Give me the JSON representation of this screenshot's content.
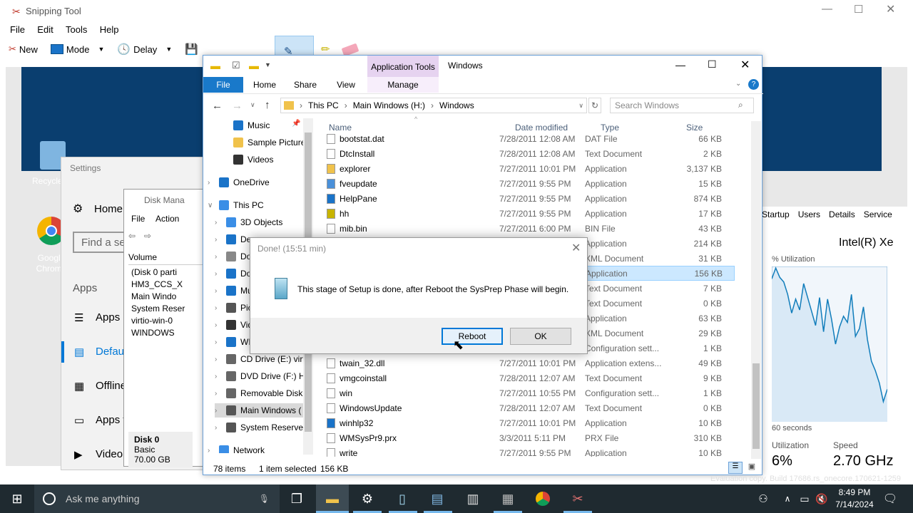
{
  "snipping": {
    "title": "Snipping Tool",
    "menu": [
      "File",
      "Edit",
      "Tools",
      "Help"
    ],
    "toolbar": {
      "new": "New",
      "mode": "Mode",
      "delay": "Delay"
    }
  },
  "desktop": {
    "recycle": "Recycle",
    "chrome": "Google Chrome"
  },
  "settings": {
    "title": "Settings",
    "home": "Home",
    "search_placeholder": "Find a se",
    "section": "Apps",
    "items": [
      "Apps",
      "Defaul",
      "Offline",
      "Apps f",
      "Video"
    ]
  },
  "diskmgmt": {
    "title": "Disk Mana",
    "menu": [
      "File",
      "Action"
    ],
    "col": "Volume",
    "vols": [
      "(Disk 0 parti",
      "HM3_CCS_X",
      "Main Windo",
      "System Reser",
      "virtio-win-0",
      "WINDOWS"
    ],
    "disk": "Disk 0",
    "basic": "Basic",
    "size": "70.00 GB"
  },
  "taskmgr": {
    "tabs": [
      "Startup",
      "Users",
      "Details",
      "Service"
    ],
    "cpu": "Intel(R) Xe",
    "util_label": "% Utilization",
    "seconds": "60 seconds",
    "utilization": "Utilization",
    "speed": "Speed",
    "util_val": "6%",
    "speed_val": "2.70 GHz",
    "graph": [
      92,
      99,
      93,
      90,
      82,
      70,
      79,
      72,
      89,
      80,
      71,
      62,
      80,
      58,
      79,
      66,
      50,
      61,
      68,
      64,
      82,
      55,
      60,
      74,
      53,
      39,
      33,
      25,
      13,
      21
    ]
  },
  "explorer": {
    "context_tab": "Application Tools",
    "title": "Windows",
    "tabs": {
      "file": "File",
      "home": "Home",
      "share": "Share",
      "view": "View",
      "manage": "Manage"
    },
    "path": [
      "This PC",
      "Main Windows (H:)",
      "Windows"
    ],
    "search_placeholder": "Search Windows",
    "cols": {
      "name": "Name",
      "date": "Date modified",
      "type": "Type",
      "size": "Size"
    },
    "nav": [
      {
        "label": "Music",
        "icon": "music-note-icon",
        "color": "#1a73c8"
      },
      {
        "label": "Sample Pictures",
        "icon": "folder-icon",
        "color": "#f0c24b"
      },
      {
        "label": "Videos",
        "icon": "video-icon",
        "color": "#333"
      },
      {
        "label": "OneDrive",
        "icon": "cloud-icon",
        "color": "#1a73c8"
      },
      {
        "label": "This PC",
        "icon": "computer-icon",
        "color": "#3a8ee6"
      },
      {
        "label": "3D Objects",
        "icon": "cube-icon",
        "color": "#3a8ee6"
      },
      {
        "label": "De",
        "icon": "desktop-icon",
        "color": "#1a73c8"
      },
      {
        "label": "Do",
        "icon": "document-icon",
        "color": "#888"
      },
      {
        "label": "Do",
        "icon": "download-icon",
        "color": "#1a73c8"
      },
      {
        "label": "Mu",
        "icon": "music-note-icon",
        "color": "#1a73c8"
      },
      {
        "label": "Pic",
        "icon": "picture-icon",
        "color": "#555"
      },
      {
        "label": "Vid",
        "icon": "video-icon",
        "color": "#333"
      },
      {
        "label": "WI",
        "icon": "drive-icon",
        "color": "#1a73c8"
      },
      {
        "label": "CD Drive (E:) virt",
        "icon": "cd-icon",
        "color": "#666"
      },
      {
        "label": "DVD Drive (F:) H",
        "icon": "dvd-icon",
        "color": "#666"
      },
      {
        "label": "Removable Disk",
        "icon": "usb-icon",
        "color": "#666"
      },
      {
        "label": "Main Windows (",
        "icon": "drive-icon",
        "color": "#555"
      },
      {
        "label": "System Reserved",
        "icon": "drive-icon",
        "color": "#555"
      },
      {
        "label": "Network",
        "icon": "network-icon",
        "color": "#3a8ee6"
      }
    ],
    "files": [
      {
        "name": "bootstat.dat",
        "date": "7/28/2011 12:08 AM",
        "type": "DAT File",
        "size": "66 KB"
      },
      {
        "name": "DtcInstall",
        "date": "7/28/2011 12:08 AM",
        "type": "Text Document",
        "size": "2 KB"
      },
      {
        "name": "explorer",
        "date": "7/27/2011 10:01 PM",
        "type": "Application",
        "size": "3,137 KB"
      },
      {
        "name": "fveupdate",
        "date": "7/27/2011 9:55 PM",
        "type": "Application",
        "size": "15 KB"
      },
      {
        "name": "HelpPane",
        "date": "7/27/2011 9:55 PM",
        "type": "Application",
        "size": "874 KB"
      },
      {
        "name": "hh",
        "date": "7/27/2011 9:55 PM",
        "type": "Application",
        "size": "17 KB"
      },
      {
        "name": "mib.bin",
        "date": "7/27/2011 6:00 PM",
        "type": "BIN File",
        "size": "43 KB"
      },
      {
        "name": "",
        "date": "",
        "type": "Application",
        "size": "214 KB"
      },
      {
        "name": "",
        "date": "",
        "type": "XML Document",
        "size": "31 KB"
      },
      {
        "name": "",
        "date": "",
        "type": "Application",
        "size": "156 KB"
      },
      {
        "name": "",
        "date": "",
        "type": "Text Document",
        "size": "7 KB"
      },
      {
        "name": "",
        "date": "",
        "type": "Text Document",
        "size": "0 KB"
      },
      {
        "name": "",
        "date": "",
        "type": "Application",
        "size": "63 KB"
      },
      {
        "name": "",
        "date": "",
        "type": "XML Document",
        "size": "29 KB"
      },
      {
        "name": "",
        "date": "",
        "type": "Configuration sett...",
        "size": "1 KB"
      },
      {
        "name": "twain_32.dll",
        "date": "7/27/2011 10:01 PM",
        "type": "Application extens...",
        "size": "49 KB"
      },
      {
        "name": "vmgcoinstall",
        "date": "7/28/2011 12:07 AM",
        "type": "Text Document",
        "size": "9 KB"
      },
      {
        "name": "win",
        "date": "7/27/2011 10:55 PM",
        "type": "Configuration sett...",
        "size": "1 KB"
      },
      {
        "name": "WindowsUpdate",
        "date": "7/28/2011 12:07 AM",
        "type": "Text Document",
        "size": "0 KB"
      },
      {
        "name": "winhlp32",
        "date": "7/27/2011 10:01 PM",
        "type": "Application",
        "size": "10 KB"
      },
      {
        "name": "WMSysPr9.prx",
        "date": "3/3/2011 5:11 PM",
        "type": "PRX File",
        "size": "310 KB"
      },
      {
        "name": "write",
        "date": "7/27/2011 9:55 PM",
        "type": "Application",
        "size": "10 KB"
      }
    ],
    "selected_index": 9,
    "status": {
      "items": "78 items",
      "selected": "1 item selected",
      "size": "156 KB"
    }
  },
  "dialog": {
    "title": "Done! (15:51 min)",
    "message": "This stage of Setup is done, after Reboot the SysPrep Phase will begin.",
    "reboot": "Reboot",
    "ok": "OK"
  },
  "taskbar": {
    "search_placeholder": "Ask me anything",
    "time": "8:49 PM",
    "date": "7/14/2024",
    "watermark": "Evaluation copy. Build 17686.rs_onecore.170621-1259"
  }
}
